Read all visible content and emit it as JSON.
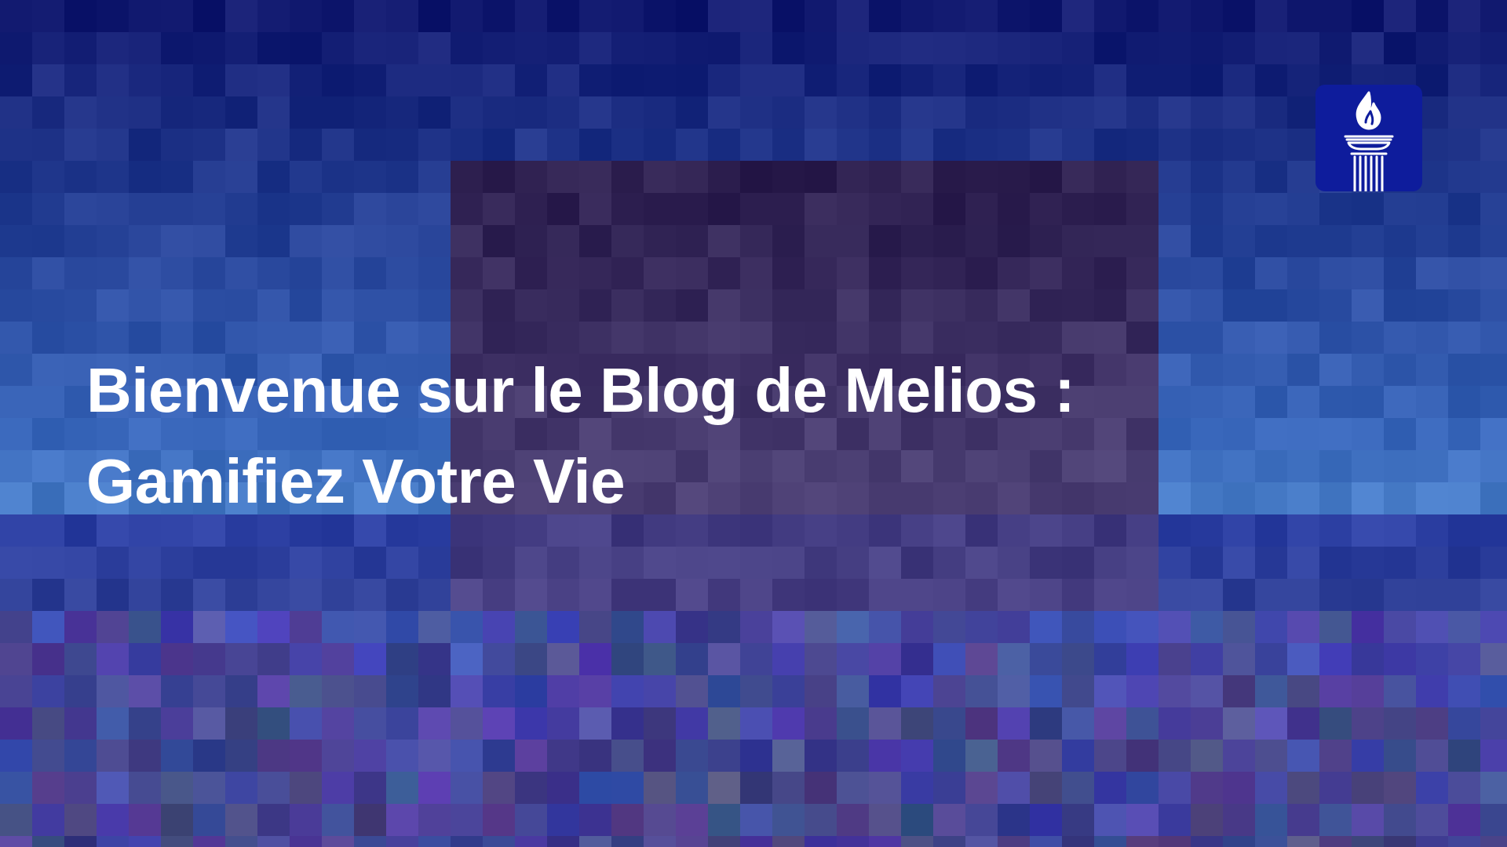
{
  "banner": {
    "headline_line1": "Bienvenue sur le Blog de Melios :",
    "headline_line2": "Gamifiez Votre Vie"
  },
  "logo": {
    "icon": "torch-pillar-icon",
    "background_color": "#0e1c9c"
  },
  "colors": {
    "background_top": "#141a6e",
    "text": "#ffffff"
  }
}
